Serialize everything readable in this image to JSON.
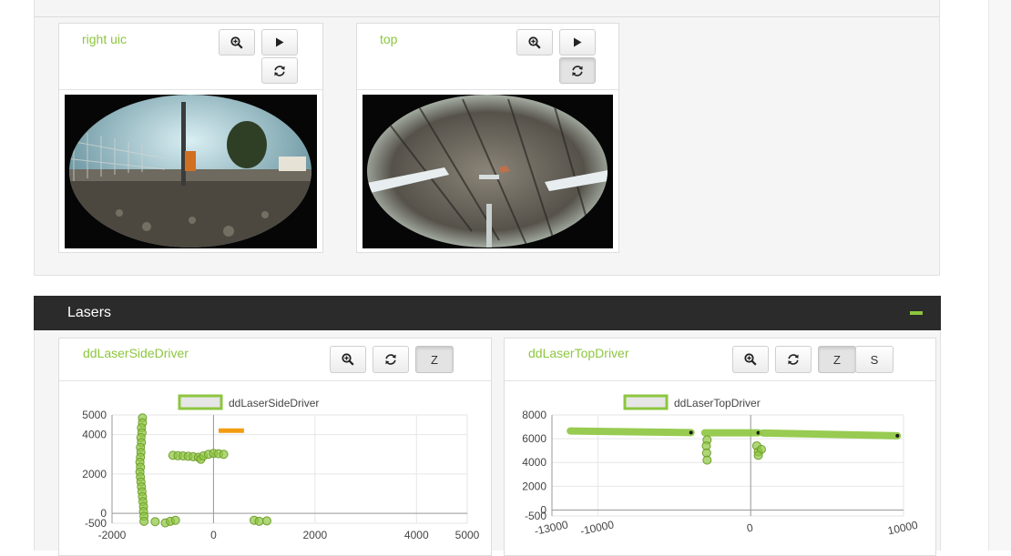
{
  "cameras": [
    {
      "title": "right uic"
    },
    {
      "title": "top"
    }
  ],
  "icons": {
    "zoom": "zoom-in-icon",
    "play": "play-icon",
    "refresh": "refresh-icon"
  },
  "lasers": {
    "title": "Lasers",
    "accent": "#8dc63f",
    "header_bg": "#2b2b2b",
    "side": {
      "title": "ddLaserSideDriver",
      "buttons": {
        "z": "Z"
      }
    },
    "top": {
      "title": "ddLaserTopDriver",
      "buttons": {
        "z": "Z",
        "s": "S"
      }
    }
  },
  "chart_data": [
    {
      "type": "scatter",
      "name": "ddLaserSideDriver",
      "legend": "ddLaserSideDriver",
      "xlim": [
        -2000,
        5000
      ],
      "ylim": [
        -500,
        5000
      ],
      "x_ticks": [
        "-2000",
        "0",
        "2000",
        "4000",
        "5000"
      ],
      "y_ticks": [
        "5000",
        "4000",
        "2000",
        "0",
        "-500"
      ],
      "marker_color": "#8dc63f",
      "highlight_color": "#f39c12",
      "series": [
        {
          "name": "ddLaserSideDriver",
          "points": [
            [
              -1400,
              4850
            ],
            [
              -1400,
              4600
            ],
            [
              -1420,
              4350
            ],
            [
              -1410,
              4100
            ],
            [
              -1430,
              3850
            ],
            [
              -1420,
              3600
            ],
            [
              -1440,
              3350
            ],
            [
              -1430,
              3100
            ],
            [
              -1440,
              2850
            ],
            [
              -1450,
              2600
            ],
            [
              -1440,
              2350
            ],
            [
              -1450,
              2100
            ],
            [
              -1440,
              1850
            ],
            [
              -1430,
              1600
            ],
            [
              -1420,
              1350
            ],
            [
              -1410,
              1100
            ],
            [
              -1400,
              850
            ],
            [
              -1390,
              600
            ],
            [
              -1380,
              350
            ],
            [
              -1380,
              100
            ],
            [
              -1370,
              -150
            ],
            [
              -1370,
              -400
            ],
            [
              -800,
              2950
            ],
            [
              -700,
              2930
            ],
            [
              -600,
              2920
            ],
            [
              -500,
              2900
            ],
            [
              -400,
              2880
            ],
            [
              -300,
              2850
            ],
            [
              -250,
              2750
            ],
            [
              -200,
              2920
            ],
            [
              -100,
              3000
            ],
            [
              0,
              3050
            ],
            [
              100,
              3030
            ],
            [
              200,
              3000
            ],
            [
              -1150,
              -420
            ],
            [
              -950,
              -480
            ],
            [
              -850,
              -400
            ],
            [
              -750,
              -350
            ],
            [
              800,
              -350
            ],
            [
              900,
              -400
            ],
            [
              1050,
              -380
            ]
          ]
        }
      ],
      "highlight_segment": {
        "x": [
          100,
          600
        ],
        "y": 4200
      }
    },
    {
      "type": "scatter",
      "name": "ddLaserTopDriver",
      "legend": "ddLaserTopDriver",
      "xlim": [
        -13000,
        10000
      ],
      "ylim": [
        -500,
        8000
      ],
      "x_ticks": [
        "-13000",
        "-10000",
        "0",
        "10000"
      ],
      "y_ticks": [
        "8000",
        "6000",
        "4000",
        "2000",
        "-500",
        "0"
      ],
      "marker_color": "#8dc63f",
      "series": [
        {
          "name": "ddLaserTopDriver",
          "segments": [
            {
              "x": [
                -11800,
                -3900
              ],
              "y": [
                6650,
                6520
              ]
            },
            {
              "x": [
                -3000,
                500
              ],
              "y": [
                6500,
                6500
              ]
            },
            {
              "x": [
                800,
                9600
              ],
              "y": [
                6480,
                6250
              ]
            }
          ],
          "points": [
            [
              -2850,
              5900
            ],
            [
              -2900,
              5400
            ],
            [
              -2880,
              4800
            ],
            [
              -2850,
              4200
            ],
            [
              400,
              5400
            ],
            [
              500,
              4900
            ],
            [
              700,
              5100
            ],
            [
              500,
              4600
            ]
          ]
        }
      ]
    }
  ]
}
